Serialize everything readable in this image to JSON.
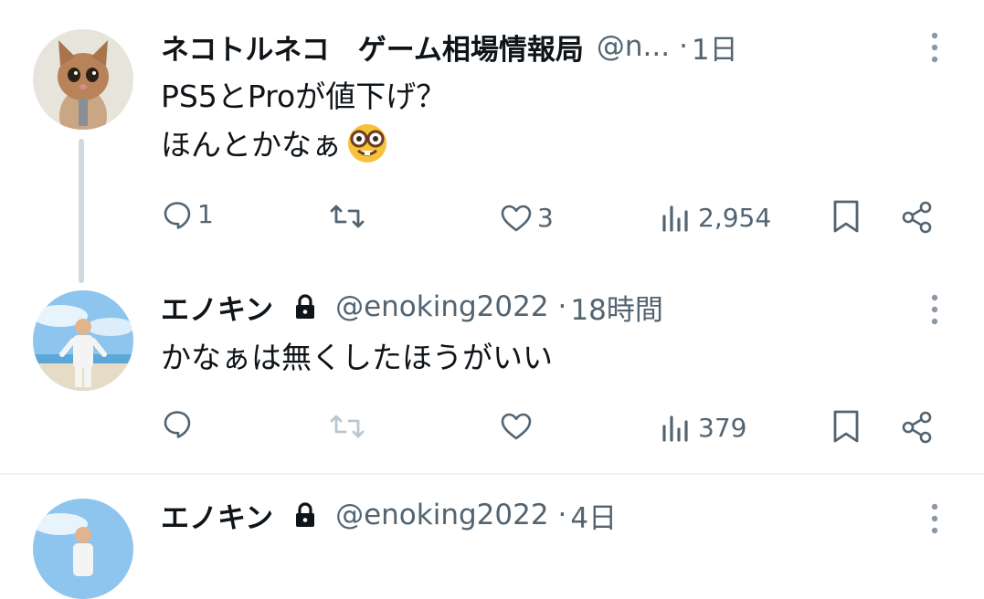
{
  "tweets": [
    {
      "name": "ネコトルネコ　ゲーム相場情報局",
      "handle": "@n...",
      "time": "1日",
      "lines": [
        "PS5とProが値下げ？",
        "ほんとかなぁ"
      ],
      "replies": "1",
      "retweets": "",
      "likes": "3",
      "views": "2,954"
    },
    {
      "name": "エノキン",
      "handle": "@enoking2022",
      "time": "18時間",
      "lines": [
        "かなぁは無くしたほうがいい"
      ],
      "replies": "",
      "retweets": "",
      "likes": "",
      "views": "379"
    },
    {
      "name": "エノキン",
      "handle": "@enoking2022",
      "time": "4日"
    }
  ],
  "separator": "·",
  "icons": {
    "reply": "reply-icon",
    "retweet": "retweet-icon",
    "like": "heart-icon",
    "views": "views-icon",
    "bookmark": "bookmark-icon",
    "share": "share-icon",
    "more": "more-vertical-icon",
    "lock": "lock-icon",
    "emoji": "nerd-face-emoji"
  },
  "colors": {
    "text": "#0f1419",
    "secondary": "#536471",
    "thread_line": "#cfd9de",
    "divider": "#eff3f4",
    "retweet_disabled": "#b8c7d0"
  }
}
